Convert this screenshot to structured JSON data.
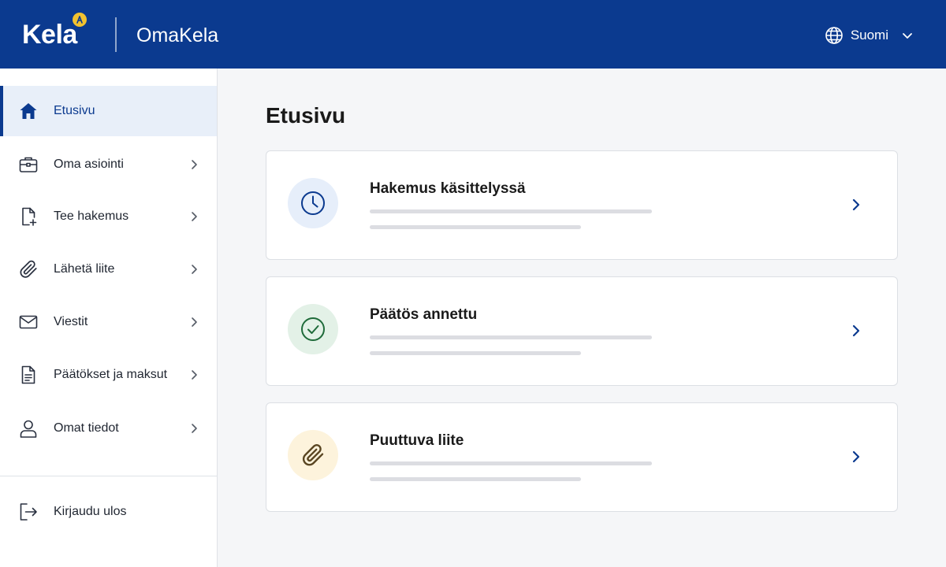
{
  "header": {
    "logo_text": "Kela",
    "app_name": "OmaKela",
    "language": "Suomi",
    "icons": {
      "language": "globe-icon",
      "dropdown": "chevron-down-icon"
    }
  },
  "sidebar": {
    "items": [
      {
        "label": "Etusivu",
        "icon": "home-icon",
        "active": true
      },
      {
        "label": "Oma asiointi",
        "icon": "briefcase-icon"
      },
      {
        "label": "Tee hakemus",
        "icon": "file-plus-icon"
      },
      {
        "label": "Lähetä liite",
        "icon": "paperclip-icon"
      },
      {
        "label": "Viestit",
        "icon": "mail-icon"
      },
      {
        "label": "Päätökset ja maksut",
        "icon": "document-icon"
      },
      {
        "label": "Omat tiedot",
        "icon": "user-icon"
      }
    ],
    "logout": {
      "label": "Kirjaudu ulos",
      "icon": "logout-icon"
    }
  },
  "main": {
    "title": "Etusivu",
    "cards": [
      {
        "title": "Hakemus käsittelyssä",
        "icon": "clock-icon",
        "icon_bg": "#e6eefa",
        "icon_color": "#0b3a8f"
      },
      {
        "title": "Päätös annettu",
        "icon": "check-circle-icon",
        "icon_bg": "#e3f1e7",
        "icon_color": "#1f6b3a"
      },
      {
        "title": "Puuttuva liite",
        "icon": "paperclip-icon",
        "icon_bg": "#fdf3dc",
        "icon_color": "#5a4622"
      }
    ]
  },
  "colors": {
    "brand": "#0b3a8f",
    "logo_accent": "#f2c230"
  }
}
